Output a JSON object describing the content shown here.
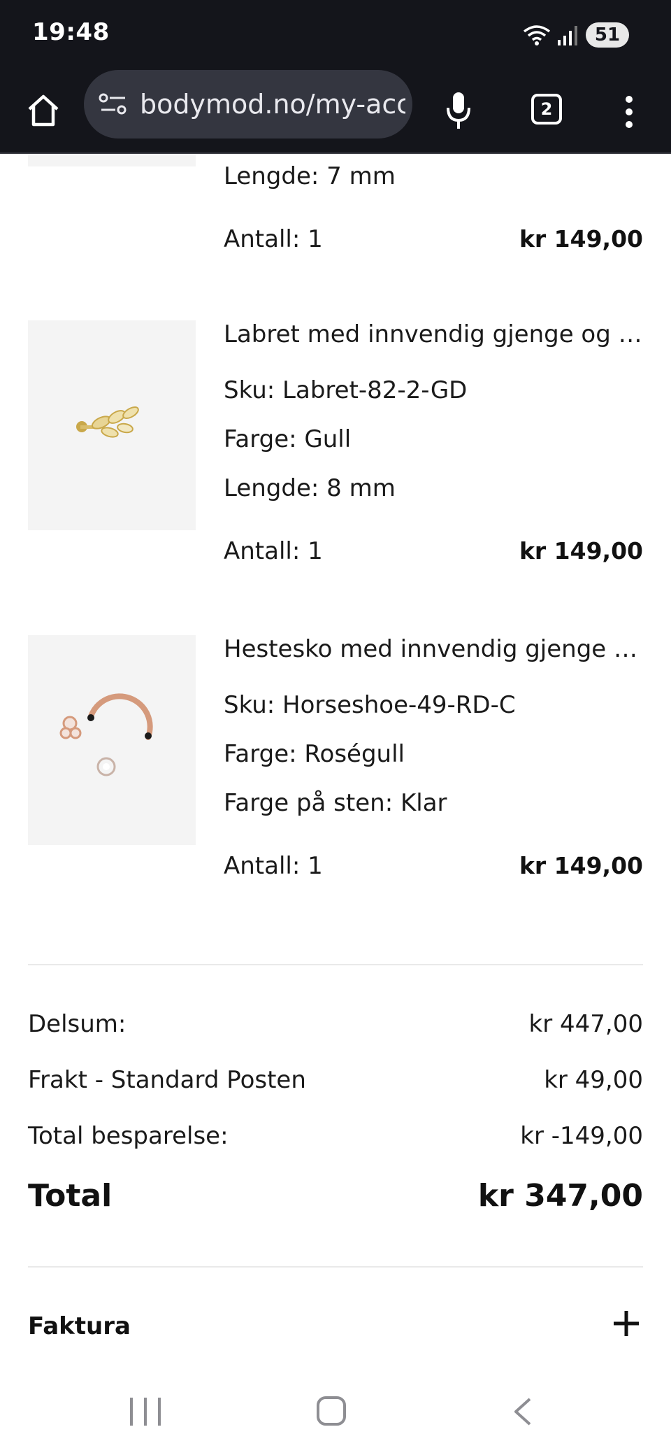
{
  "status_bar": {
    "time": "19:48",
    "battery": "51"
  },
  "browser": {
    "url": "bodymod.no/my-acc",
    "tab_count": "2"
  },
  "previous_item": {
    "length": "Lengde: 7 mm",
    "quantity": "Antall: 1",
    "price": "kr 149,00"
  },
  "items": [
    {
      "name": "Labret med innvendig gjenge og bl...",
      "sku": "Sku: Labret-82-2-GD",
      "color": "Farge: Gull",
      "extra": "Lengde: 8 mm",
      "quantity": "Antall: 1",
      "price": "kr 149,00"
    },
    {
      "name": "Hestesko med innvendig gjenge o...",
      "sku": "Sku: Horseshoe-49-RD-C",
      "color": "Farge: Roségull",
      "extra": "Farge på sten: Klar",
      "quantity": "Antall: 1",
      "price": "kr 149,00"
    }
  ],
  "summary": {
    "subtotal_label": "Delsum:",
    "subtotal_value": "kr 447,00",
    "shipping_label": "Frakt - Standard Posten",
    "shipping_value": "kr 49,00",
    "savings_label": "Total besparelse:",
    "savings_value": "kr -149,00",
    "total_label": "Total",
    "total_value": "kr 347,00"
  },
  "invoice": {
    "label": "Faktura"
  },
  "colors": {
    "status_bg": "#14151b",
    "urlbar_bg": "#343640",
    "thumb_bg": "#f4f4f4",
    "gold": "#d4b24a",
    "rose_gold": "#d59a7c"
  }
}
